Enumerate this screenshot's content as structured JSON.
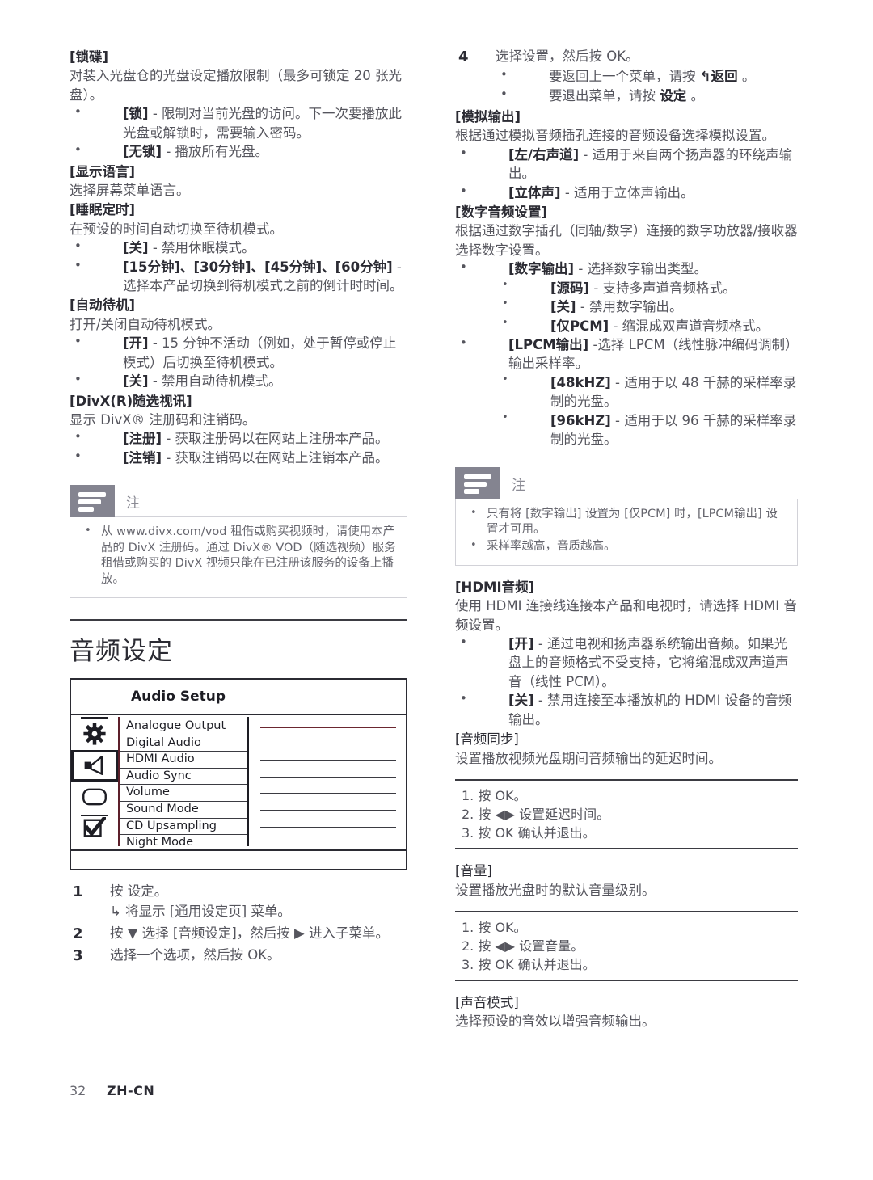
{
  "page": {
    "number": "32",
    "language": "ZH-CN"
  },
  "left": {
    "blocks": [
      {
        "kind": "hdr",
        "text": "[锁碟]"
      },
      {
        "kind": "para",
        "text": "对装入光盘仓的光盘设定播放限制（最多可锁定 20 张光盘）。"
      },
      {
        "kind": "li1",
        "term": "[锁]",
        "text": " - 限制对当前光盘的访问。下一次要播放此光盘或解锁时，需要输入密码。"
      },
      {
        "kind": "li1",
        "term": "[无锁]",
        "text": " - 播放所有光盘。"
      },
      {
        "kind": "hdr",
        "text": "[显示语言]"
      },
      {
        "kind": "para",
        "text": "选择屏幕菜单语言。"
      },
      {
        "kind": "hdr",
        "text": "[睡眠定时]"
      },
      {
        "kind": "para",
        "text": "在预设的时间自动切换至待机模式。"
      },
      {
        "kind": "li1",
        "term": "[关]",
        "text": " - 禁用休眠模式。"
      },
      {
        "kind": "li1",
        "term": "[15分钟]、[30分钟]、[45分钟]、[60分钟]",
        "text": " - 选择本产品切换到待机模式之前的倒计时时间。"
      },
      {
        "kind": "hdr",
        "text": "[自动待机]"
      },
      {
        "kind": "para",
        "text": "打开/关闭自动待机模式。"
      },
      {
        "kind": "li1",
        "term": "[开]",
        "text": " - 15 分钟不活动（例如，处于暂停或停止模式）后切换至待机模式。"
      },
      {
        "kind": "li1",
        "term": "[关]",
        "text": " - 禁用自动待机模式。"
      },
      {
        "kind": "hdr",
        "text": "[DivX(R)随选视讯]"
      },
      {
        "kind": "para",
        "text": "显示 DivX® 注册码和注销码。"
      },
      {
        "kind": "li1",
        "term": "[注册]",
        "text": " - 获取注册码以在网站上注册本产品。"
      },
      {
        "kind": "li1",
        "term": "[注销]",
        "text": " - 获取注销码以在网站上注销本产品。"
      }
    ],
    "note": {
      "icon": "note-lines-icon",
      "title": "注",
      "items": [
        "从 www.divx.com/vod 租借或购买视频时，请使用本产品的 DivX 注册码。通过 DivX® VOD（随选视频）服务租借或购买的 DivX 视频只能在已注册该服务的设备上播放。"
      ]
    },
    "section_title": "音频设定",
    "screen": {
      "title": "Audio Setup",
      "icons": [
        {
          "name": "gear-icon",
          "selected": false
        },
        {
          "name": "speaker-icon",
          "selected": true
        },
        {
          "name": "display-icon",
          "selected": false
        },
        {
          "name": "checkbox-icon",
          "selected": false
        }
      ],
      "rows": [
        "Analogue Output",
        "Digital Audio",
        "HDMI Audio",
        "Audio Sync",
        "Volume",
        "Sound Mode",
        "CD Upsampling",
        "Night Mode"
      ],
      "value_lines": 7,
      "highlight_color": "#6b2730"
    },
    "steps": [
      {
        "num": "1",
        "text": "按 设定。",
        "bold_part": "设定",
        "sub": "↳  将显示 [通用设定页] 菜单。"
      },
      {
        "num": "2",
        "text": "按 ▼ 选择 [音频设定]，然后按 ▶ 进入子菜单。"
      },
      {
        "num": "3",
        "text": "选择一个选项，然后按 OK。"
      }
    ]
  },
  "right": {
    "step4": {
      "num": "4",
      "text": "选择设置，然后按 OK。"
    },
    "step4_bullets": [
      {
        "text": "要返回上一个菜单，请按 ",
        "key": "↰返回",
        "tail": " 。"
      },
      {
        "text": "要退出菜单，请按 ",
        "key": "设定",
        "tail": " 。"
      }
    ],
    "blocks": [
      {
        "kind": "hdr",
        "text": "[模拟输出]"
      },
      {
        "kind": "para",
        "text": "根据通过模拟音频插孔连接的音频设备选择模拟设置。"
      },
      {
        "kind": "li1",
        "term": "[左/右声道]",
        "text": " - 适用于来自两个扬声器的环绕声输出。"
      },
      {
        "kind": "li1",
        "term": "[立体声]",
        "text": " - 适用于立体声输出。"
      },
      {
        "kind": "hdr",
        "text": "[数字音频设置]"
      },
      {
        "kind": "para",
        "text": "根据通过数字插孔（同轴/数字）连接的数字功放器/接收器选择数字设置。"
      },
      {
        "kind": "li1",
        "term": "[数字输出]",
        "text": " - 选择数字输出类型。"
      },
      {
        "kind": "li2",
        "term": "[源码]",
        "text": " - 支持多声道音频格式。"
      },
      {
        "kind": "li2",
        "term": "[关]",
        "text": " - 禁用数字输出。"
      },
      {
        "kind": "li2",
        "term": "[仅PCM]",
        "text": " - 缩混成双声道音频格式。"
      },
      {
        "kind": "li1",
        "term": "[LPCM输出]",
        "text": " -选择 LPCM（线性脉冲编码调制）输出采样率。"
      },
      {
        "kind": "li2",
        "term": "[48kHZ]",
        "text": " - 适用于以 48 千赫的采样率录制的光盘。"
      },
      {
        "kind": "li2",
        "term": "[96kHZ]",
        "text": " - 适用于以 96 千赫的采样率录制的光盘。"
      }
    ],
    "note": {
      "icon": "note-lines-icon",
      "title": "注",
      "items": [
        "只有将 [数字输出] 设置为 [仅PCM] 时，[LPCM输出] 设置才可用。",
        "采样率越高，音质越高。"
      ]
    },
    "blocks2": [
      {
        "kind": "hdr",
        "text": "[HDMI音频]"
      },
      {
        "kind": "para",
        "text": "使用 HDMI 连接线连接本产品和电视时，请选择 HDMI 音频设置。"
      },
      {
        "kind": "li1",
        "term": "[开]",
        "text": " - 通过电视和扬声器系统输出音频。如果光盘上的音频格式不受支持，它将缩混成双声道声音（线性 PCM）。"
      },
      {
        "kind": "li1",
        "term": "[关]",
        "text": " - 禁用连接至本播放机的 HDMI 设备的音频输出。"
      },
      {
        "kind": "hdr2",
        "text": "[音频同步]"
      },
      {
        "kind": "para",
        "text": "设置播放视频光盘期间音频输出的延迟时间。"
      }
    ],
    "rulebox1": [
      "1. 按 OK。",
      "2. 按 ◀▶ 设置延迟时间。",
      "3. 按 OK 确认并退出。"
    ],
    "blocks3": [
      {
        "kind": "hdr2",
        "text": "[音量]"
      },
      {
        "kind": "para",
        "text": "设置播放光盘时的默认音量级别。"
      }
    ],
    "rulebox2": [
      "1. 按 OK。",
      "2. 按 ◀▶ 设置音量。",
      "3. 按 OK 确认并退出。"
    ],
    "blocks4": [
      {
        "kind": "hdr2",
        "text": "[声音模式]"
      },
      {
        "kind": "para",
        "text": "选择预设的音效以增强音频输出。"
      }
    ]
  }
}
